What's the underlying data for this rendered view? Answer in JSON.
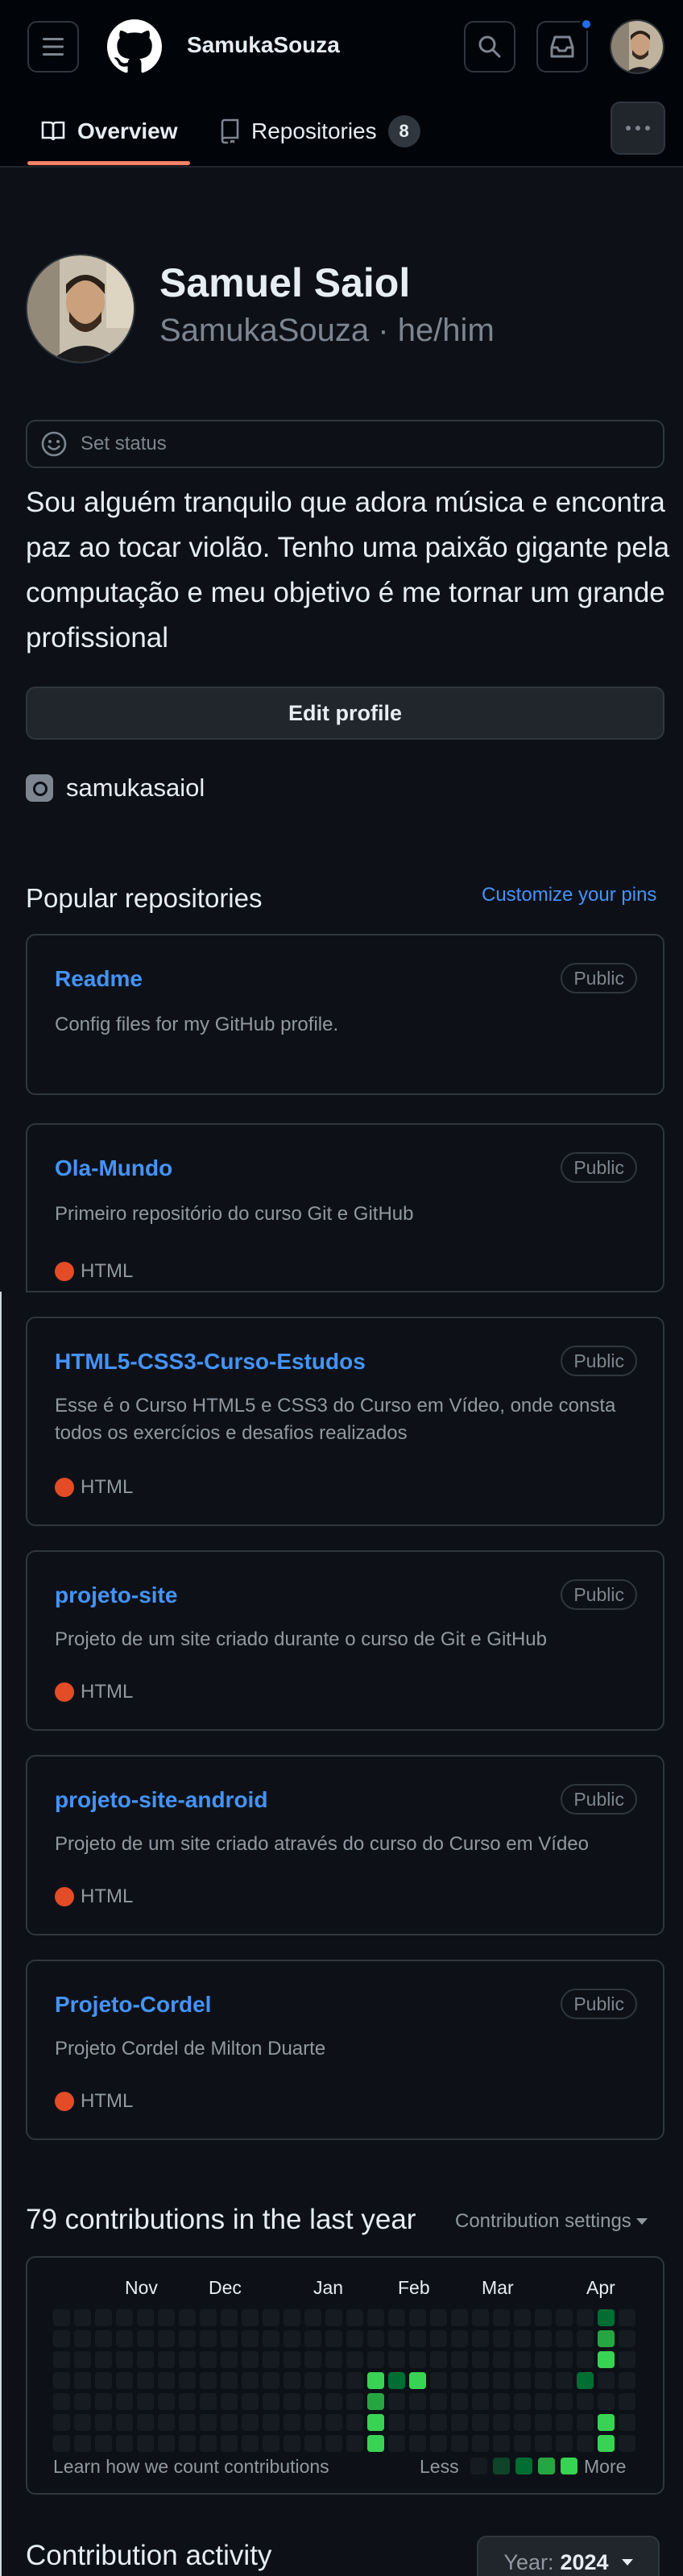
{
  "header": {
    "username": "SamukaSouza",
    "icons": [
      "menu-icon",
      "github-logo",
      "search-icon",
      "inbox-icon",
      "avatar"
    ],
    "accent": "#1f6feb"
  },
  "tabs": [
    {
      "label": "Overview",
      "active": true
    },
    {
      "label": "Repositories",
      "count": "8",
      "active": false
    }
  ],
  "profile": {
    "name": "Samuel Saiol",
    "login_line": "SamukaSouza · he/him",
    "status_label": "Set status",
    "bio": "Sou alguém tranquilo que adora música e encontra paz ao tocar violão. Tenho uma paixão gigante pela computação e meu objetivo é me tornar um grande profissional",
    "edit_label": "Edit profile",
    "social": "samukasaiol"
  },
  "popular": {
    "title": "Popular repositories",
    "customize": "Customize your pins",
    "repos": [
      {
        "name": "Readme",
        "visibility": "Public",
        "description": "Config files for my GitHub profile.",
        "language": ""
      },
      {
        "name": "Ola-Mundo",
        "visibility": "Public",
        "description": "Primeiro repositório do curso Git e GitHub",
        "language": "HTML"
      },
      {
        "name": "HTML5-CSS3-Curso-Estudos",
        "visibility": "Public",
        "description": "Esse é o Curso HTML5 e CSS3 do Curso em Vídeo, onde consta todos os exercícios e desafios realizados",
        "language": "HTML"
      },
      {
        "name": "projeto-site",
        "visibility": "Public",
        "description": "Projeto de um site criado durante o curso de Git e GitHub",
        "language": "HTML"
      },
      {
        "name": "projeto-site-android",
        "visibility": "Public",
        "description": "Projeto de um site criado através do curso do Curso em Vídeo",
        "language": "HTML"
      },
      {
        "name": "Projeto-Cordel",
        "visibility": "Public",
        "description": "Projeto Cordel de Milton Duarte",
        "language": "HTML"
      }
    ],
    "language_color": "#e34c26"
  },
  "contributions": {
    "title": "79 contributions in the last year",
    "settings": "Contribution settings",
    "months": [
      "Nov",
      "Dec",
      "Jan",
      "Feb",
      "Mar",
      "Apr"
    ],
    "learn": "Learn how we count contributions",
    "less": "Less",
    "more": "More",
    "colors": [
      "#161b22",
      "#0e4429",
      "#006d32",
      "#26a641",
      "#39d353"
    ]
  },
  "activity": {
    "title": "Contribution activity",
    "year_prefix": "Year:",
    "year": "2024"
  }
}
